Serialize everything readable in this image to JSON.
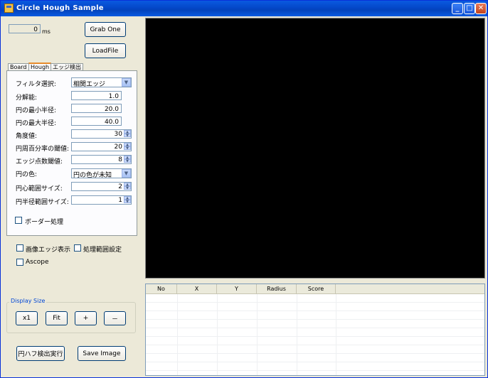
{
  "window": {
    "title": "Circle Hough Sample",
    "controls": {
      "minimize": "_",
      "maximize": "□",
      "close": "✕"
    }
  },
  "timing": {
    "value": "0",
    "unit": "ms"
  },
  "buttons": {
    "grab_one": "Grab One",
    "load_file": "LoadFile",
    "x1": "x1",
    "fit": "Fit",
    "plus": "+",
    "minus": "－",
    "run_hough": "円ハフ検出実行",
    "save_image": "Save Image"
  },
  "tabs": [
    {
      "label": "Board"
    },
    {
      "label": "Hough"
    },
    {
      "label": "エッジ検出"
    }
  ],
  "hough": {
    "filter": {
      "label": "フィルタ選択:",
      "value": "相関エッジ"
    },
    "resolution": {
      "label": "分解能:",
      "value": "1.0"
    },
    "min_radius": {
      "label": "円の最小半径:",
      "value": "20.0"
    },
    "max_radius": {
      "label": "円の最大半径:",
      "value": "40.0"
    },
    "angle": {
      "label": "角度値:",
      "value": "30"
    },
    "circ_threshold": {
      "label": "円周百分率の閾値:",
      "value": "20"
    },
    "edge_threshold": {
      "label": "エッジ点数閾値:",
      "value": "8"
    },
    "circle_color": {
      "label": "円の色:",
      "value": "円の色が未知"
    },
    "center_range": {
      "label": "円心範囲サイズ:",
      "value": "2"
    },
    "radius_range": {
      "label": "円半径範囲サイズ:",
      "value": "1"
    },
    "border": {
      "label": "ボーダー処理",
      "checked": false
    }
  },
  "options": {
    "show_edge": {
      "label": "画像エッジ表示",
      "checked": false
    },
    "roi": {
      "label": "処理範囲設定",
      "checked": false
    },
    "ascope": {
      "label": "Ascope",
      "checked": false
    }
  },
  "display_size": {
    "title": "Display Size"
  },
  "results": {
    "columns": [
      "No",
      "X",
      "Y",
      "Radius",
      "Score"
    ],
    "rows": []
  },
  "colors": {
    "title_bar": "#0a5ae0",
    "window_bg": "#ece9d8",
    "video_bg": "#000000",
    "group_title": "#0046d5"
  }
}
